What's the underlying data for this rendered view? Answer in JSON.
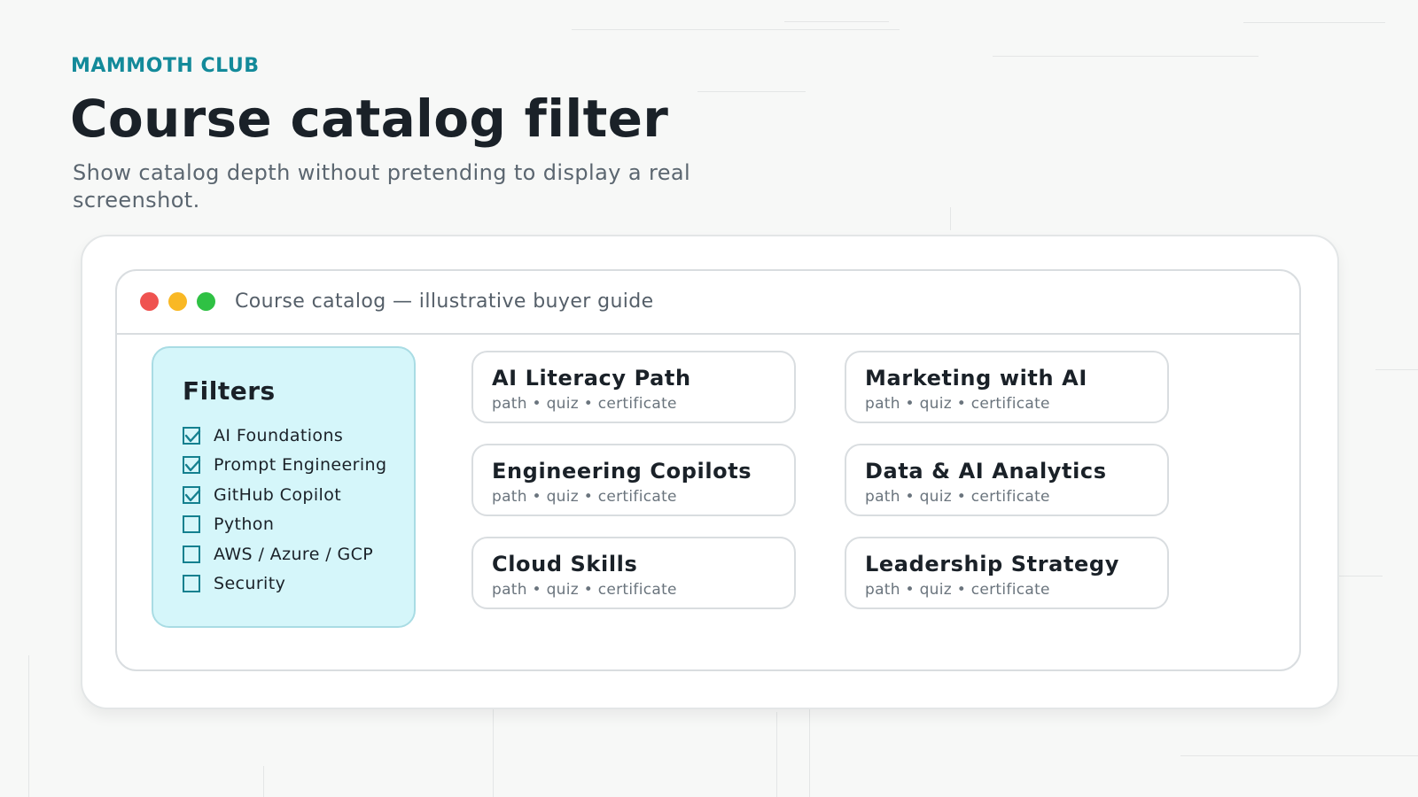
{
  "brand": "MAMMOTH CLUB",
  "title": "Course catalog filter",
  "subtitle": "Show catalog depth without pretending to display a real screenshot.",
  "window": {
    "title": "Course catalog — illustrative buyer guide"
  },
  "filters": {
    "heading": "Filters",
    "items": [
      {
        "label": "AI Foundations",
        "checked": true
      },
      {
        "label": "Prompt Engineering",
        "checked": true
      },
      {
        "label": "GitHub Copilot",
        "checked": true
      },
      {
        "label": "Python",
        "checked": false
      },
      {
        "label": "AWS / Azure / GCP",
        "checked": false
      },
      {
        "label": "Security",
        "checked": false
      }
    ]
  },
  "courses": [
    {
      "title": "AI Literacy Path",
      "meta": "path • quiz • certificate"
    },
    {
      "title": "Marketing with AI",
      "meta": "path • quiz • certificate"
    },
    {
      "title": "Engineering Copilots",
      "meta": "path • quiz • certificate"
    },
    {
      "title": "Data & AI Analytics",
      "meta": "path • quiz • certificate"
    },
    {
      "title": "Cloud Skills",
      "meta": "path • quiz • certificate"
    },
    {
      "title": "Leadership Strategy",
      "meta": "path • quiz • certificate"
    }
  ],
  "colors": {
    "brand": "#138a9a",
    "filter_panel": "#d5f6fa",
    "check": "#14808f",
    "dot_red": "#ef5350",
    "dot_yellow": "#f9b824",
    "dot_green": "#2fc144"
  }
}
